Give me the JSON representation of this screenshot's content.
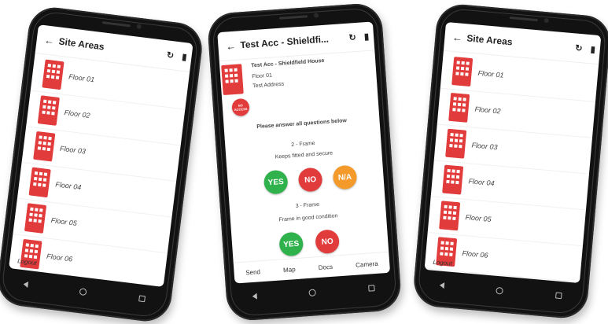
{
  "site_areas": {
    "title": "Site Areas",
    "refresh_icon": "refresh-icon",
    "docs_icon": "documents-icon",
    "items": [
      "Floor 01",
      "Floor 02",
      "Floor 03",
      "Floor 04",
      "Floor 05",
      "Floor 06"
    ],
    "logout": "Logout"
  },
  "questions": {
    "title": "Test Acc - Shieldfi...",
    "site_name": "Test Acc - Shieldfield House",
    "floor": "Floor 01",
    "address": "Test Address",
    "no_access": "NO ACCESS",
    "instruction": "Please answer all questions below",
    "q1_title": "2 - Frame",
    "q1_text": "Keeps fitted and secure",
    "q2_title": "3 - Frame",
    "q2_text": "Frame in good condition",
    "yes": "YES",
    "no": "NO",
    "na": "N/A",
    "tabs": [
      "Send",
      "Map",
      "Docs",
      "Camera"
    ]
  },
  "colors": {
    "red": "#e23b3b",
    "green": "#2fb24b",
    "orange": "#f39a2b"
  }
}
